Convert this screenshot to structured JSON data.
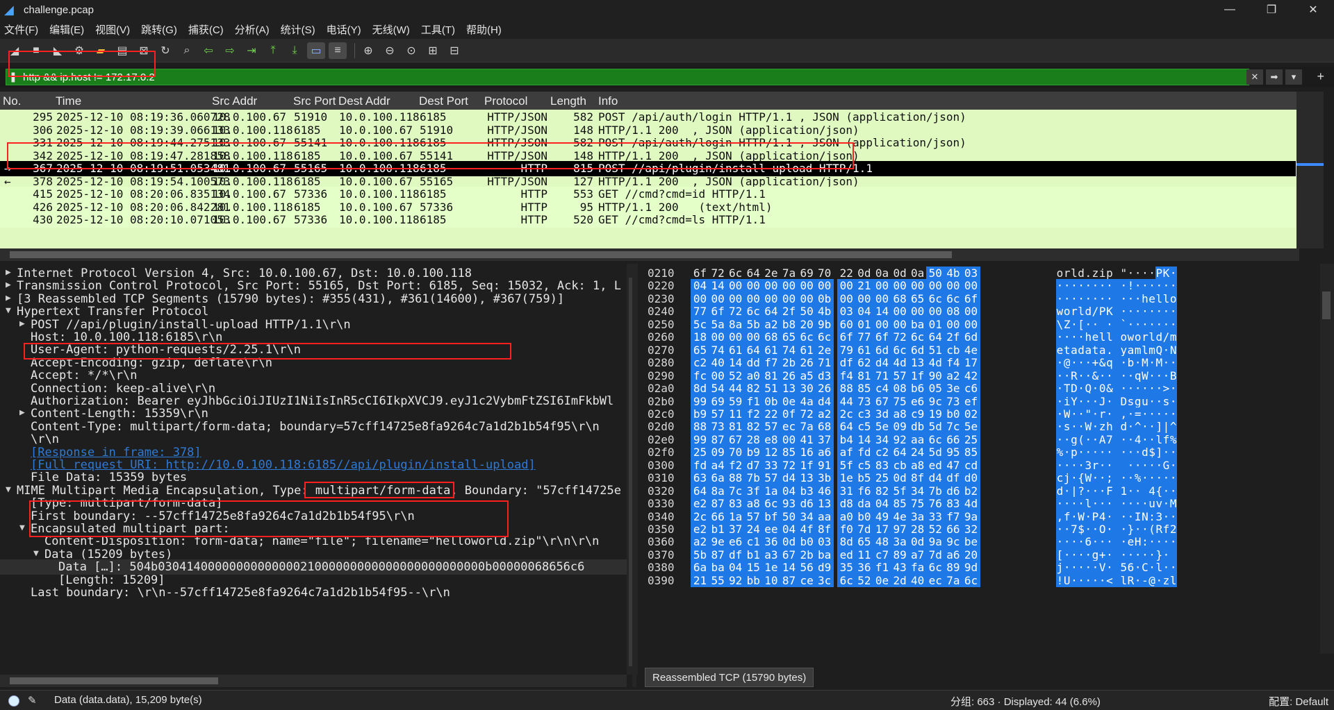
{
  "window": {
    "title": "challenge.pcap",
    "controls": {
      "minimize": "—",
      "maximize": "❐",
      "close": "✕"
    }
  },
  "menu": [
    "文件(F)",
    "编辑(E)",
    "视图(V)",
    "跳转(G)",
    "捕获(C)",
    "分析(A)",
    "统计(S)",
    "电话(Y)",
    "无线(W)",
    "工具(T)",
    "帮助(H)"
  ],
  "toolbar_icons": [
    "shark-fin-start-icon",
    "stop-icon",
    "restart-icon",
    "options-gear-icon",
    "open-folder-icon",
    "open-recent-icon",
    "close-file-icon",
    "reload-icon",
    "find-icon",
    "go-back-icon",
    "go-forward-icon",
    "go-to-packet-icon",
    "first-packet-icon",
    "last-packet-icon",
    "autoscroll-icon",
    "colorize-icon",
    "zoom-in-icon",
    "zoom-out-icon",
    "normal-size-icon",
    "resize-columns-icon",
    "layout-icon"
  ],
  "filter": {
    "value": "http && ip.host != 172.17.0.2",
    "bookmark_icon": "bookmark-icon",
    "clear_icon": "clear-icon",
    "apply_icon": "apply-arrow-icon",
    "dropdown_icon": "▾",
    "add_icon": "+"
  },
  "packet_list": {
    "columns": [
      "No.",
      "Time",
      "Src Addr",
      "Src Port",
      "Dest Addr",
      "Dest Port",
      "Protocol",
      "Length",
      "Info"
    ],
    "rows": [
      {
        "no": "295",
        "time": "2025-12-10 08:19:36.060728",
        "src": "10.0.100.67",
        "sport": "51910",
        "dst": "10.0.100.118",
        "dport": "6185",
        "proto": "HTTP/JSON",
        "len": "582",
        "info": "POST /api/auth/login HTTP/1.1 , JSON (application/json)",
        "mark": ""
      },
      {
        "no": "306",
        "time": "2025-12-10 08:19:39.066133",
        "src": "10.0.100.118",
        "sport": "6185",
        "dst": "10.0.100.67",
        "dport": "51910",
        "proto": "HTTP/JSON",
        "len": "148",
        "info": "HTTP/1.1 200  , JSON (application/json)",
        "mark": ""
      },
      {
        "no": "331",
        "time": "2025-12-10 08:19:44.275133",
        "src": "10.0.100.67",
        "sport": "55141",
        "dst": "10.0.100.118",
        "dport": "6185",
        "proto": "HTTP/JSON",
        "len": "582",
        "info": "POST /api/auth/login HTTP/1.1 , JSON (application/json)",
        "mark": ""
      },
      {
        "no": "342",
        "time": "2025-12-10 08:19:47.281858",
        "src": "10.0.100.118",
        "sport": "6185",
        "dst": "10.0.100.67",
        "dport": "55141",
        "proto": "HTTP/JSON",
        "len": "148",
        "info": "HTTP/1.1 200  , JSON (application/json)",
        "mark": ""
      },
      {
        "no": "367",
        "time": "2025-12-10 08:19:51.053481",
        "src": "10.0.100.67",
        "sport": "55165",
        "dst": "10.0.100.118",
        "dport": "6185",
        "proto": "HTTP",
        "len": "815",
        "info": "POST //api/plugin/install-upload HTTP/1.1",
        "mark": "→",
        "selected": true
      },
      {
        "no": "378",
        "time": "2025-12-10 08:19:54.100573",
        "src": "10.0.100.118",
        "sport": "6185",
        "dst": "10.0.100.67",
        "dport": "55165",
        "proto": "HTTP/JSON",
        "len": "127",
        "info": "HTTP/1.1 200  , JSON (application/json)",
        "mark": "←"
      },
      {
        "no": "415",
        "time": "2025-12-10 08:20:06.835134",
        "src": "10.0.100.67",
        "sport": "57336",
        "dst": "10.0.100.118",
        "dport": "6185",
        "proto": "HTTP",
        "len": "553",
        "info": "GET //cmd?cmd=id HTTP/1.1",
        "mark": ""
      },
      {
        "no": "426",
        "time": "2025-12-10 08:20:06.842281",
        "src": "10.0.100.118",
        "sport": "6185",
        "dst": "10.0.100.67",
        "dport": "57336",
        "proto": "HTTP",
        "len": "95",
        "info": "HTTP/1.1 200   (text/html)",
        "mark": ""
      },
      {
        "no": "430",
        "time": "2025-12-10 08:20:10.071053",
        "src": "10.0.100.67",
        "sport": "57336",
        "dst": "10.0.100.118",
        "dport": "6185",
        "proto": "HTTP",
        "len": "520",
        "info": "GET //cmd?cmd=ls HTTP/1.1",
        "mark": ""
      }
    ]
  },
  "details": [
    {
      "arrow": "▶",
      "indent": 0,
      "text": "Internet Protocol Version 4, Src: 10.0.100.67, Dst: 10.0.100.118"
    },
    {
      "arrow": "▶",
      "indent": 0,
      "text": "Transmission Control Protocol, Src Port: 55165, Dst Port: 6185, Seq: 15032, Ack: 1, L"
    },
    {
      "arrow": "▶",
      "indent": 0,
      "text": "[3 Reassembled TCP Segments (15790 bytes): #355(431), #361(14600), #367(759)]"
    },
    {
      "arrow": "▼",
      "indent": 0,
      "text": "Hypertext Transfer Protocol"
    },
    {
      "arrow": "▶",
      "indent": 1,
      "text": "POST //api/plugin/install-upload HTTP/1.1\\r\\n"
    },
    {
      "arrow": "",
      "indent": 1,
      "text": "Host: 10.0.100.118:6185\\r\\n"
    },
    {
      "arrow": "",
      "indent": 1,
      "text": "User-Agent: python-requests/2.25.1\\r\\n"
    },
    {
      "arrow": "",
      "indent": 1,
      "text": "Accept-Encoding: gzip, deflate\\r\\n"
    },
    {
      "arrow": "",
      "indent": 1,
      "text": "Accept: */*\\r\\n"
    },
    {
      "arrow": "",
      "indent": 1,
      "text": "Connection: keep-alive\\r\\n"
    },
    {
      "arrow": "",
      "indent": 1,
      "text": "Authorization: Bearer eyJhbGciOiJIUzI1NiIsInR5cCI6IkpXVCJ9.eyJ1c2VybmFtZSI6ImFkbWl"
    },
    {
      "arrow": "▶",
      "indent": 1,
      "text": "Content-Length: 15359\\r\\n"
    },
    {
      "arrow": "",
      "indent": 1,
      "text": "Content-Type: multipart/form-data; boundary=57cff14725e8fa9264c7a1d2b1b54f95\\r\\n"
    },
    {
      "arrow": "",
      "indent": 1,
      "text": "\\r\\n"
    },
    {
      "arrow": "",
      "indent": 1,
      "text": "[Response in frame: 378]",
      "link": true
    },
    {
      "arrow": "",
      "indent": 1,
      "text": "[Full request URI: http://10.0.100.118:6185//api/plugin/install-upload]",
      "link": true
    },
    {
      "arrow": "",
      "indent": 1,
      "text": "File Data: 15359 bytes"
    },
    {
      "arrow": "▼",
      "indent": 0,
      "text": "MIME Multipart Media Encapsulation, Type: multipart/form-data, Boundary: \"57cff14725e"
    },
    {
      "arrow": "",
      "indent": 1,
      "text": "[Type: multipart/form-data]"
    },
    {
      "arrow": "",
      "indent": 1,
      "text": "First boundary: --57cff14725e8fa9264c7a1d2b1b54f95\\r\\n"
    },
    {
      "arrow": "▼",
      "indent": 1,
      "text": "Encapsulated multipart part:"
    },
    {
      "arrow": "",
      "indent": 2,
      "text": "Content-Disposition: form-data; name=\"file\"; filename=\"helloworld.zip\"\\r\\n\\r\\n"
    },
    {
      "arrow": "▼",
      "indent": 2,
      "text": "Data (15209 bytes)"
    },
    {
      "arrow": "",
      "indent": 3,
      "text": "Data […]: 504b0304140000000000000021000000000000000000000000b00000068656c6",
      "highlight": true
    },
    {
      "arrow": "",
      "indent": 3,
      "text": "[Length: 15209]"
    },
    {
      "arrow": "",
      "indent": 1,
      "text": "Last boundary: \\r\\n--57cff14725e8fa9264c7a1d2b1b54f95--\\r\\n"
    }
  ],
  "hex": [
    {
      "off": "0210",
      "bytes": "6f 72 6c 64 2e 7a 69 70 22 0d 0a 0d 0a 50 4b 03",
      "ascii": "orld.zip \"····PK·",
      "hi_from": 13
    },
    {
      "off": "0220",
      "bytes": "04 14 00 00 00 00 00 00 00 21 00 00 00 00 00 00",
      "ascii": "········ ·!······",
      "hi_from": 0
    },
    {
      "off": "0230",
      "bytes": "00 00 00 00 00 00 00 0b 00 00 00 68 65 6c 6c 6f",
      "ascii": "········ ···hello",
      "hi_from": 0
    },
    {
      "off": "0240",
      "bytes": "77 6f 72 6c 64 2f 50 4b 03 04 14 00 00 00 08 00",
      "ascii": "world/PK ········",
      "hi_from": 0
    },
    {
      "off": "0250",
      "bytes": "5c 5a 8a 5b a2 b8 20 9b 60 01 00 00 ba 01 00 00",
      "ascii": "\\Z·[·· · `·······",
      "hi_from": 0
    },
    {
      "off": "0260",
      "bytes": "18 00 00 00 68 65 6c 6c 6f 77 6f 72 6c 64 2f 6d",
      "ascii": "····hell oworld/m",
      "hi_from": 0
    },
    {
      "off": "0270",
      "bytes": "65 74 61 64 61 74 61 2e 79 61 6d 6c 6d 51 cb 4e",
      "ascii": "etadata. yamlmQ·N",
      "hi_from": 0
    },
    {
      "off": "0280",
      "bytes": "c2 40 14 dd f7 2b 26 71 df 62 d4 4d 13 4d f4 17",
      "ascii": "·@···+&q ·b·M·M··",
      "hi_from": 0
    },
    {
      "off": "0290",
      "bytes": "fc 00 52 a0 81 26 a5 d3 f4 81 71 57 1f 90 a2 42",
      "ascii": "··R··&·· ··qW···B",
      "hi_from": 0
    },
    {
      "off": "02a0",
      "bytes": "8d 54 44 82 51 13 30 26 88 85 c4 08 b6 05 3e c6",
      "ascii": "·TD·Q·0& ······>·",
      "hi_from": 0
    },
    {
      "off": "02b0",
      "bytes": "99 69 59 f1 0b 0e 4a d4 44 73 67 75 e6 9c 73 ef",
      "ascii": "·iY···J· Dsgu··s·",
      "hi_from": 0
    },
    {
      "off": "02c0",
      "bytes": "b9 57 11 f2 22 0f 72 a2 2c c3 3d a8 c9 19 b0 02",
      "ascii": "·W··\"·r· ,·=·····",
      "hi_from": 0
    },
    {
      "off": "02d0",
      "bytes": "88 73 81 82 57 ec 7a 68 64 c5 5e 09 db 5d 7c 5e",
      "ascii": "·s··W·zh d·^··]|^",
      "hi_from": 0
    },
    {
      "off": "02e0",
      "bytes": "99 87 67 28 e8 00 41 37 b4 14 34 92 aa 6c 66 25",
      "ascii": "··g(··A7 ··4··lf%",
      "hi_from": 0
    },
    {
      "off": "02f0",
      "bytes": "25 09 70 b9 12 85 16 a6 af fd c2 64 24 5d 95 85",
      "ascii": "%·p····· ···d$]··",
      "hi_from": 0
    },
    {
      "off": "0300",
      "bytes": "fd a4 f2 d7 33 72 1f 91 5f c5 83 cb a8 ed 47 cd",
      "ascii": "····3r·· _·····G·",
      "hi_from": 0
    },
    {
      "off": "0310",
      "bytes": "63 6a 88 7b 57 d4 13 3b 1e b5 25 0d 8f d4 df d0",
      "ascii": "cj·{W··; ··%·····",
      "hi_from": 0
    },
    {
      "off": "0320",
      "bytes": "64 8a 7c 3f 1a 04 b3 46 31 f6 82 5f 34 7b d6 b2",
      "ascii": "d·|?···F 1··_4{··",
      "hi_from": 0
    },
    {
      "off": "0330",
      "bytes": "e2 87 83 a8 6c 93 d6 13 d8 da 04 85 75 76 83 4d",
      "ascii": "····l··· ····uv·M",
      "hi_from": 0
    },
    {
      "off": "0340",
      "bytes": "2c 66 1a 57 bf 50 34 aa a0 b0 49 4e 3a 33 f7 9a",
      "ascii": ",f·W·P4· ··IN:3··",
      "hi_from": 0
    },
    {
      "off": "0350",
      "bytes": "e2 b1 37 24 ee 04 4f 8f f0 7d 17 97 28 52 66 32",
      "ascii": "··7$··O· ·}··(Rf2",
      "hi_from": 0
    },
    {
      "off": "0360",
      "bytes": "a2 9e e6 c1 36 0d b0 03 8d 65 48 3a 0d 9a 9c be",
      "ascii": "····6··· ·eH:····",
      "hi_from": 0
    },
    {
      "off": "0370",
      "bytes": "5b 87 df b1 a3 67 2b ba ed 11 c7 89 a7 7d a6 20",
      "ascii": "[····g+· ·····}· ",
      "hi_from": 0
    },
    {
      "off": "0380",
      "bytes": "6a ba 04 15 1e 14 56 d9 35 36 f1 43 fa 6c 89 9d",
      "ascii": "j·····V· 56·C·l··",
      "hi_from": 0
    },
    {
      "off": "0390",
      "bytes": "21 55 92 bb 10 87 ce 3c 6c 52 0e 2d 40 ec 7a 6c",
      "ascii": "!U·····< lR·-@·zl",
      "hi_from": 0
    }
  ],
  "hex_tab": "Reassembled TCP (15790 bytes)",
  "status": {
    "message": "Data (data.data), 15,209 byte(s)",
    "packets": "分组: 663 · Displayed: 44 (6.6%)",
    "profile": "配置: Default"
  },
  "colors": {
    "http_row": "#e4ffc7",
    "selected_row": "#000000",
    "filter_ok": "#1a7f1a",
    "hex_highlight": "#1e78e6",
    "annotation_red": "#ff2020"
  }
}
